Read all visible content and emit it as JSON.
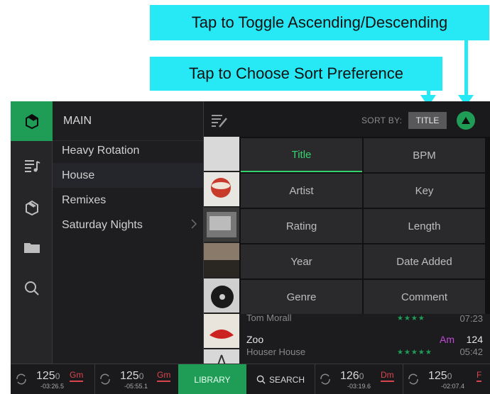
{
  "callouts": {
    "toggle": "Tap to Toggle Ascending/Descending",
    "sort": "Tap to Choose Sort Preference"
  },
  "rail": {
    "icons": [
      "library-crate-icon",
      "playlist-icon",
      "crates-icon",
      "folder-icon",
      "search-icon"
    ]
  },
  "playlists": {
    "header": "MAIN",
    "items": [
      {
        "label": "Heavy Rotation"
      },
      {
        "label": "House"
      },
      {
        "label": "Remixes"
      },
      {
        "label": "Saturday Nights"
      }
    ]
  },
  "track_header": {
    "sort_label": "SORT BY:",
    "sort_value": "TITLE"
  },
  "sort_options": [
    {
      "label": "Title",
      "active": true
    },
    {
      "label": "BPM"
    },
    {
      "label": "Artist"
    },
    {
      "label": "Key"
    },
    {
      "label": "Rating"
    },
    {
      "label": "Length"
    },
    {
      "label": "Year"
    },
    {
      "label": "Date Added"
    },
    {
      "label": "Genre"
    },
    {
      "label": "Comment"
    }
  ],
  "tracks": [
    {
      "artist": "Tom Morall",
      "stars": "★★★★",
      "length": "07:23"
    },
    {
      "title": "Zoo",
      "artist": "Houser House",
      "key": "Am",
      "bpm": "124",
      "stars": "★★★★★",
      "length": "05:42"
    }
  ],
  "bottom_bar": {
    "decks": [
      {
        "bpm_main": "125",
        "bpm_dec": "0",
        "key": "Gm",
        "time": "-03:26.5"
      },
      {
        "bpm_main": "125",
        "bpm_dec": "0",
        "key": "Gm",
        "time": "-05:55.1"
      },
      {
        "bpm_main": "126",
        "bpm_dec": "0",
        "key": "Dm",
        "time": "-03:19.6"
      },
      {
        "bpm_main": "125",
        "bpm_dec": "0",
        "key": "F",
        "time": "-02:07.4"
      }
    ],
    "library_label": "LIBRARY",
    "search_label": "SEARCH"
  },
  "colors": {
    "accent": "#1f9c56",
    "callout": "#27e9f6",
    "key_highlight": "#c04bd6",
    "deck_key": "#d9454d"
  }
}
